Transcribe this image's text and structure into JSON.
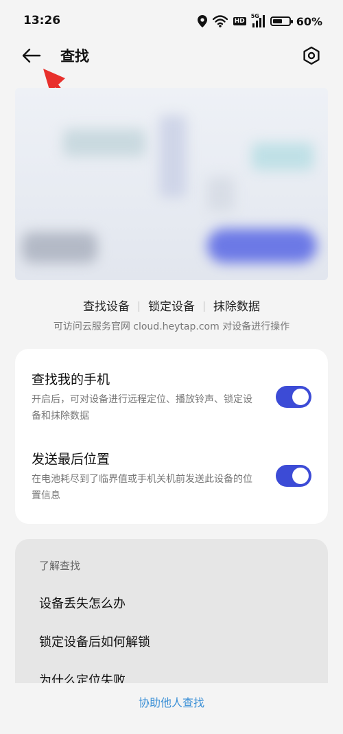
{
  "status_bar": {
    "time": "13:26",
    "network_badge": "HD",
    "signal_label": "5G",
    "battery_percent": "60%",
    "battery_level": 0.6,
    "icons": [
      "location-icon",
      "wifi-icon",
      "hd-badge",
      "cellular-signal-icon",
      "battery-icon"
    ]
  },
  "header": {
    "title": "查找",
    "back_icon": "arrow-left-icon",
    "settings_icon": "hexagon-gear-icon"
  },
  "device_actions": {
    "items": [
      "查找设备",
      "锁定设备",
      "抹除数据"
    ],
    "note": "可访问云服务官网 cloud.heytap.com 对设备进行操作"
  },
  "settings": [
    {
      "title": "查找我的手机",
      "description": "开启后，可对设备进行远程定位、播放铃声、锁定设备和抹除数据",
      "enabled": true
    },
    {
      "title": "发送最后位置",
      "description": "在电池耗尽到了临界值或手机关机前发送此设备的位置信息",
      "enabled": true
    }
  ],
  "faq": {
    "heading": "了解查找",
    "items": [
      "设备丢失怎么办",
      "锁定设备后如何解锁",
      "为什么定位失败"
    ]
  },
  "bottom_link": "协助他人查找",
  "colors": {
    "accent": "#3c4bd6",
    "link": "#3a8fd6",
    "annotation_arrow": "#e8302c",
    "background": "#f4f4f4"
  }
}
